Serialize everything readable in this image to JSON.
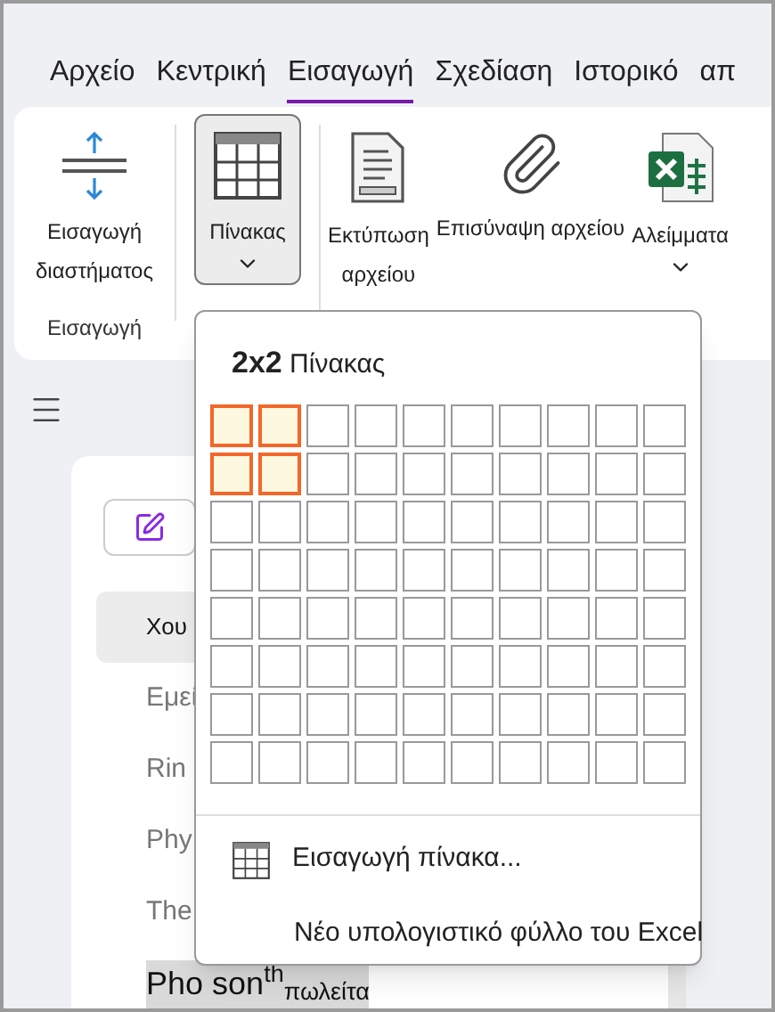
{
  "tabs": [
    {
      "label": "Αρχείο",
      "selected": false
    },
    {
      "label": "Κεντρική",
      "selected": false
    },
    {
      "label": "Εισαγωγή",
      "selected": true
    },
    {
      "label": "Σχεδίαση",
      "selected": false
    },
    {
      "label": "Ιστορικό",
      "selected": false
    },
    {
      "label": "απ",
      "selected": false
    }
  ],
  "ribbon": {
    "buttons": [
      {
        "kind": "spacing",
        "lines": [
          "Εισαγωγή",
          "διαστήματος"
        ],
        "pressed": false,
        "dropdown": false
      },
      {
        "kind": "table",
        "lines": [
          "Πίνακας"
        ],
        "pressed": true,
        "dropdown": true
      },
      {
        "kind": "printout",
        "lines": [
          "Εκτύπωση",
          "αρχείου"
        ],
        "pressed": false,
        "dropdown": false
      },
      {
        "kind": "attachment",
        "lines": [
          "Επισύναψη αρχείου"
        ],
        "pressed": false,
        "dropdown": false
      },
      {
        "kind": "spreadsheet",
        "lines": [
          "Αλείμματα"
        ],
        "pressed": false,
        "dropdown": true
      }
    ],
    "group_label": "Εισαγωγή"
  },
  "pages": [
    {
      "title": "Χου",
      "selected": true
    },
    {
      "title": "Εμεί",
      "selected": false
    },
    {
      "title": "Rin",
      "selected": false
    },
    {
      "title": "Phy",
      "selected": false
    },
    {
      "title": "The",
      "selected": false
    },
    {
      "title": "Pho son$^{th}$$_{πωλείτα}$",
      "selected": false,
      "highlighted": true
    }
  ],
  "table_menu": {
    "size_label": "2x2",
    "title": "Πίνακας",
    "grid": [
      [
        {
          "selected": true
        },
        {
          "selected": true
        },
        {
          "selected": false
        },
        {
          "selected": false
        },
        {
          "selected": false
        },
        {
          "selected": false
        },
        {
          "selected": false
        },
        {
          "selected": false
        },
        {
          "selected": false
        },
        {
          "selected": false
        }
      ],
      [
        {
          "selected": true
        },
        {
          "selected": true
        },
        {
          "selected": false
        },
        {
          "selected": false
        },
        {
          "selected": false
        },
        {
          "selected": false
        },
        {
          "selected": false
        },
        {
          "selected": false
        },
        {
          "selected": false
        },
        {
          "selected": false
        }
      ],
      [
        {
          "selected": false
        },
        {
          "selected": false
        },
        {
          "selected": false
        },
        {
          "selected": false
        },
        {
          "selected": false
        },
        {
          "selected": false
        },
        {
          "selected": false
        },
        {
          "selected": false
        },
        {
          "selected": false
        },
        {
          "selected": false
        }
      ],
      [
        {
          "selected": false
        },
        {
          "selected": false
        },
        {
          "selected": false
        },
        {
          "selected": false
        },
        {
          "selected": false
        },
        {
          "selected": false
        },
        {
          "selected": false
        },
        {
          "selected": false
        },
        {
          "selected": false
        },
        {
          "selected": false
        }
      ],
      [
        {
          "selected": false
        },
        {
          "selected": false
        },
        {
          "selected": false
        },
        {
          "selected": false
        },
        {
          "selected": false
        },
        {
          "selected": false
        },
        {
          "selected": false
        },
        {
          "selected": false
        },
        {
          "selected": false
        },
        {
          "selected": false
        }
      ],
      [
        {
          "selected": false
        },
        {
          "selected": false
        },
        {
          "selected": false
        },
        {
          "selected": false
        },
        {
          "selected": false
        },
        {
          "selected": false
        },
        {
          "selected": false
        },
        {
          "selected": false
        },
        {
          "selected": false
        },
        {
          "selected": false
        }
      ],
      [
        {
          "selected": false
        },
        {
          "selected": false
        },
        {
          "selected": false
        },
        {
          "selected": false
        },
        {
          "selected": false
        },
        {
          "selected": false
        },
        {
          "selected": false
        },
        {
          "selected": false
        },
        {
          "selected": false
        },
        {
          "selected": false
        }
      ],
      [
        {
          "selected": false
        },
        {
          "selected": false
        },
        {
          "selected": false
        },
        {
          "selected": false
        },
        {
          "selected": false
        },
        {
          "selected": false
        },
        {
          "selected": false
        },
        {
          "selected": false
        },
        {
          "selected": false
        },
        {
          "selected": false
        }
      ]
    ],
    "items": [
      {
        "kind": "icon",
        "label": "Εισαγωγή πίνακα..."
      },
      {
        "kind": "plain",
        "label": "Νέο υπολογιστικό φύλλο του Excel"
      }
    ]
  }
}
